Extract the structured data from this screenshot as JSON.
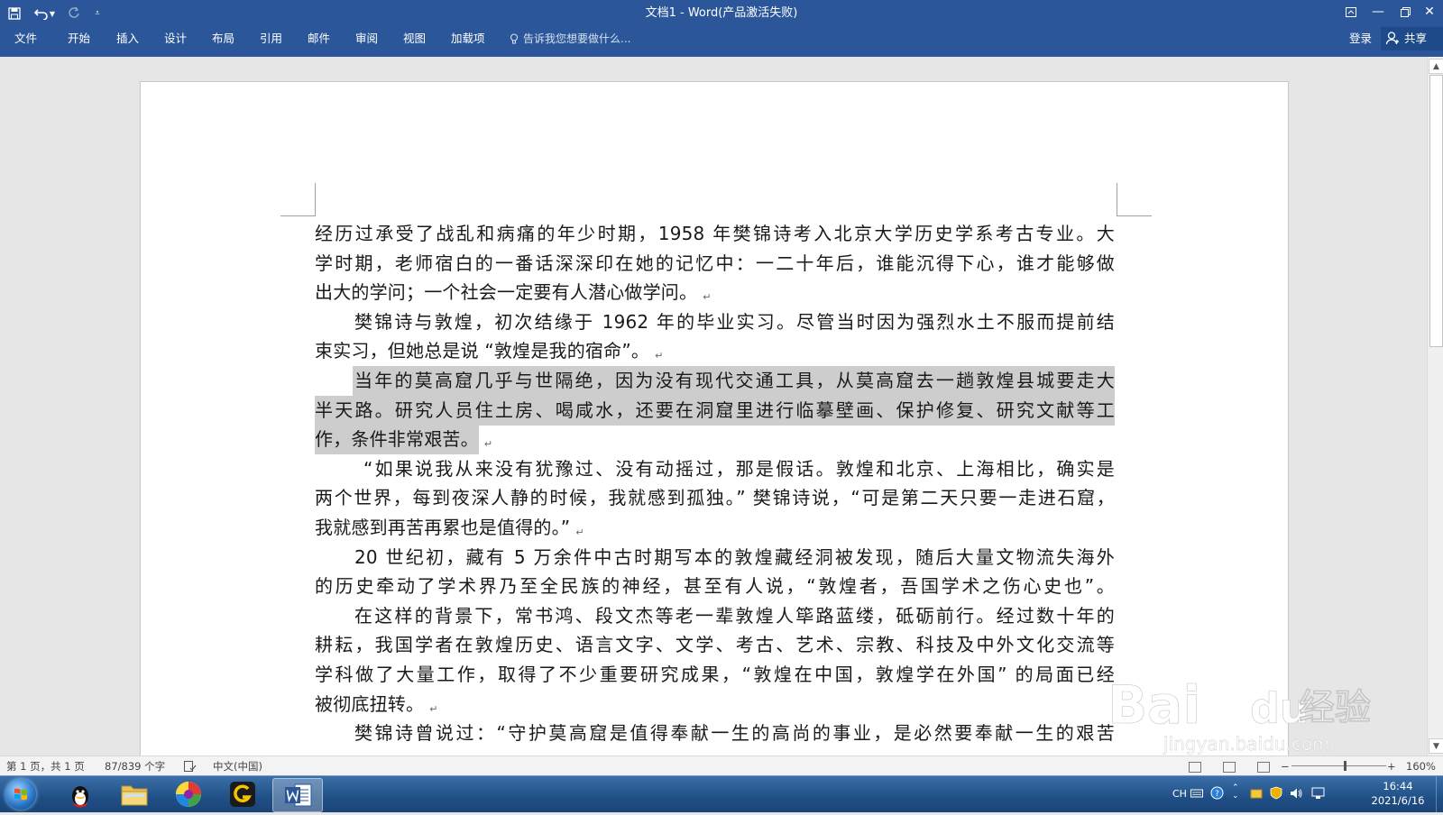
{
  "title_bar": {
    "title": "文档1 - Word(产品激活失败)"
  },
  "ribbon": {
    "tabs": [
      "文件",
      "开始",
      "插入",
      "设计",
      "布局",
      "引用",
      "邮件",
      "审阅",
      "视图",
      "加载项"
    ],
    "tell_me": "告诉我您想要做什么...",
    "login": "登录",
    "share": "共享"
  },
  "document": {
    "lines": [
      {
        "text": "经历过承受了战乱和病痛的年少时期，1958 年樊锦诗考入北京大学历史学系考古专业。大",
        "justify": true,
        "indent": 0,
        "highlight": false,
        "pilcrow": false
      },
      {
        "text": "学时期，老师宿白的一番话深深印在她的记忆中：一二十年后，谁能沉得下心，谁才能够做",
        "justify": true,
        "indent": 0,
        "highlight": false,
        "pilcrow": false
      },
      {
        "text": "出大的学问；一个社会一定要有人潜心做学问。",
        "justify": false,
        "indent": 0,
        "highlight": false,
        "pilcrow": true
      },
      {
        "text": "樊锦诗与敦煌，初次结缘于 1962 年的毕业实习。尽管当时因为强烈水土不服而提前结",
        "justify": true,
        "indent": 44,
        "highlight": false,
        "pilcrow": false
      },
      {
        "text": "束实习，但她总是说 “敦煌是我的宿命”。",
        "justify": false,
        "indent": 0,
        "highlight": false,
        "pilcrow": true
      },
      {
        "text": "当年的莫高窟几乎与世隔绝，因为没有现代交通工具，从莫高窟去一趟敦煌县城要走大",
        "justify": true,
        "indent": 44,
        "highlight": true,
        "pilcrow": false
      },
      {
        "text": "半天路。研究人员住土房、喝咸水，还要在洞窟里进行临摹壁画、保护修复、研究文献等工",
        "justify": true,
        "indent": 0,
        "highlight": true,
        "pilcrow": false
      },
      {
        "text": "作，条件非常艰苦。",
        "justify": false,
        "indent": 0,
        "highlight": true,
        "pilcrow": true
      },
      {
        "text": "“如果说我从来没有犹豫过、没有动摇过，那是假话。敦煌和北京、上海相比，确实是",
        "justify": true,
        "indent": 54,
        "highlight": false,
        "pilcrow": false
      },
      {
        "text": "两个世界，每到夜深人静的时候，我就感到孤独。” 樊锦诗说，“可是第二天只要一走进石窟，",
        "justify": true,
        "indent": 0,
        "highlight": false,
        "pilcrow": false
      },
      {
        "text": "我就感到再苦再累也是值得的。”",
        "justify": false,
        "indent": 0,
        "highlight": false,
        "pilcrow": true
      },
      {
        "text": "20 世纪初，藏有 5 万余件中古时期写本的敦煌藏经洞被发现，随后大量文物流失海外",
        "justify": true,
        "indent": 44,
        "highlight": false,
        "pilcrow": false
      },
      {
        "text": "的历史牵动了学术界乃至全民族的神经，甚至有人说，“敦煌者，吾国学术之伤心史也”。",
        "justify": true,
        "indent": 0,
        "highlight": false,
        "pilcrow": true
      },
      {
        "text": "在这样的背景下，常书鸿、段文杰等老一辈敦煌人筚路蓝缕，砥砺前行。经过数十年的",
        "justify": true,
        "indent": 44,
        "highlight": false,
        "pilcrow": false
      },
      {
        "text": "耕耘，我国学者在敦煌历史、语言文字、文学、考古、艺术、宗教、科技及中外文化交流等",
        "justify": true,
        "indent": 0,
        "highlight": false,
        "pilcrow": false
      },
      {
        "text": "学科做了大量工作，取得了不少重要研究成果，“敦煌在中国，敦煌学在外国” 的局面已经",
        "justify": true,
        "indent": 0,
        "highlight": false,
        "pilcrow": false
      },
      {
        "text": "被彻底扭转。",
        "justify": false,
        "indent": 0,
        "highlight": false,
        "pilcrow": true
      },
      {
        "text": "樊锦诗曾说过：“守护莫高窟是值得奉献一生的高尚的事业，是必然要奉献一生的艰苦",
        "justify": true,
        "indent": 44,
        "highlight": false,
        "pilcrow": false
      }
    ],
    "pilcrow": "↵"
  },
  "status_bar": {
    "page": "第 1 页，共 1 页",
    "word_count": "87/839 个字",
    "language": "中文(中国)",
    "zoom_minus": "−",
    "zoom_plus": "+",
    "zoom": "160%"
  },
  "taskbar": {
    "apps": [
      "qq",
      "file-explorer",
      "color-app",
      "g-app",
      "word"
    ],
    "tray_lang": "CH",
    "time": "16:44",
    "date": "2021/6/16"
  },
  "watermark": {
    "brand": "Bai",
    "brand2": "du",
    "cn": "经验",
    "url": "jingyan.baidu.com"
  },
  "colors": {
    "word_blue": "#2b579a",
    "highlight": "#cdcdcd"
  }
}
